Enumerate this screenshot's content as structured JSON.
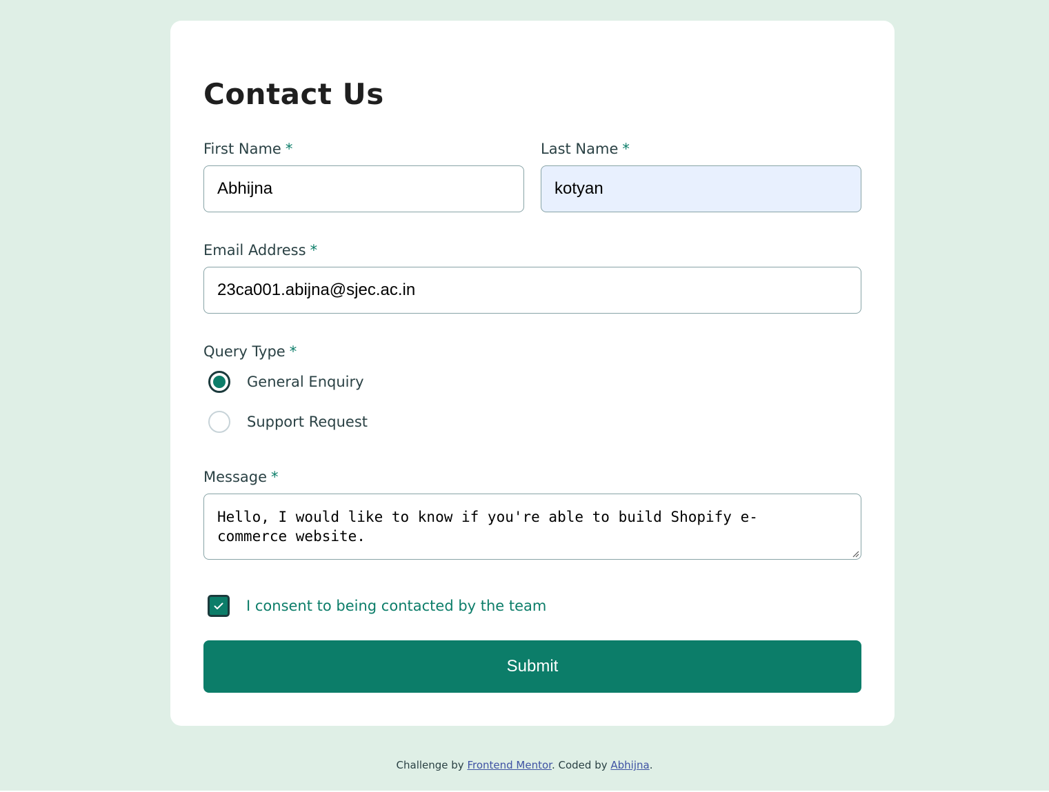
{
  "page": {
    "title": "Contact Us"
  },
  "form": {
    "required_mark": "*",
    "first_name": {
      "label": "First Name",
      "value": "Abhijna"
    },
    "last_name": {
      "label": "Last Name",
      "value": "kotyan"
    },
    "email": {
      "label": "Email Address",
      "value": "23ca001.abijna@sjec.ac.in"
    },
    "query_type": {
      "label": "Query Type",
      "options": [
        {
          "label": "General Enquiry",
          "selected": true
        },
        {
          "label": "Support Request",
          "selected": false
        }
      ]
    },
    "message": {
      "label": "Message",
      "value": "Hello, I would like to know if you're able to build Shopify e-commerce website."
    },
    "consent": {
      "label": "I consent to being contacted by the team",
      "checked": true
    },
    "submit_label": "Submit"
  },
  "footer": {
    "prefix": "Challenge by",
    "link1": "Frontend Mentor",
    "middle": ". Coded by",
    "link2": "Abhijna",
    "suffix": "."
  },
  "colors": {
    "background": "#dfefe6",
    "accent": "#0c7d69",
    "text": "#2a4144",
    "card": "#ffffff",
    "autofill": "#e8f0fe"
  }
}
